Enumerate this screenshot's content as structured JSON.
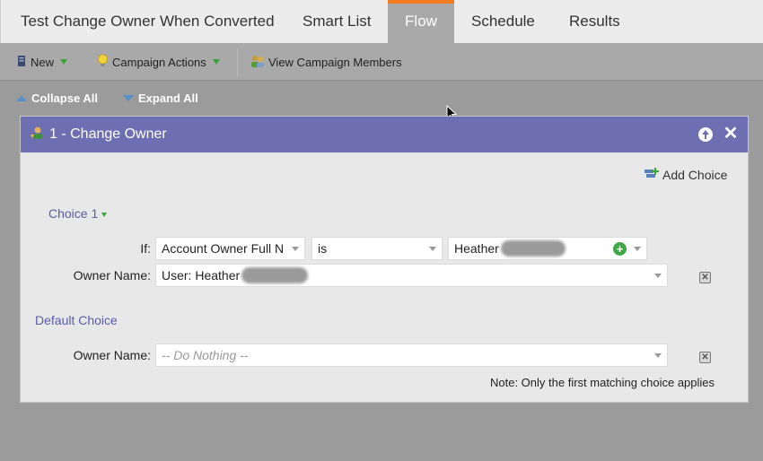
{
  "tabs": {
    "campaign_name": "Test Change Owner When Converted",
    "smart_list": "Smart List",
    "flow": "Flow",
    "schedule": "Schedule",
    "results": "Results",
    "active_tab": "Flow",
    "active_accent_color": "#f47a20"
  },
  "toolbar": {
    "new_label": "New",
    "campaign_actions_label": "Campaign Actions",
    "view_members_label": "View Campaign Members"
  },
  "tree_controls": {
    "collapse_all": "Collapse All",
    "expand_all": "Expand All"
  },
  "flow_step": {
    "title": "1 - Change Owner",
    "header_color": "#6e6fb2",
    "add_choice_label": "Add Choice",
    "choice1": {
      "label": "Choice 1",
      "if_label": "If:",
      "attribute": "Account Owner Full N",
      "operator": "is",
      "value": "Heather",
      "owner_label": "Owner Name:",
      "owner_value": "User: Heather"
    },
    "default_choice": {
      "label": "Default Choice",
      "owner_label": "Owner Name:",
      "owner_placeholder": "-- Do Nothing --"
    },
    "note": "Note: Only the first matching choice applies"
  }
}
